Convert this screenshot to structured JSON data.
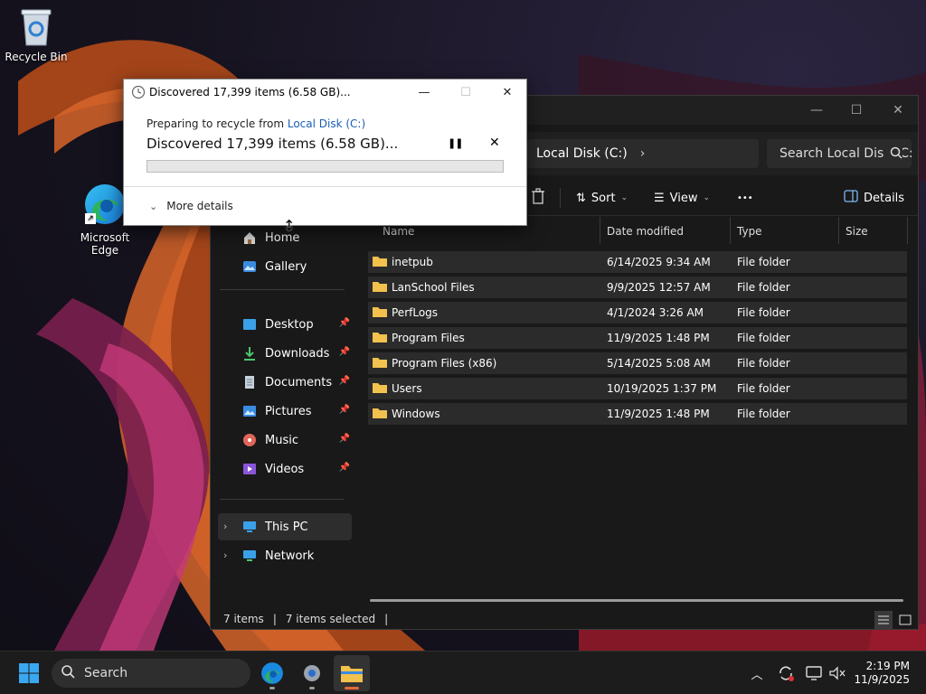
{
  "desktop": {
    "recycle_bin_label": "Recycle Bin",
    "edge_label": "Microsoft Edge"
  },
  "explorer": {
    "address": "Local Disk (C:)",
    "address_chevron": "›",
    "search_placeholder": "Search Local Disk (C:)",
    "toolbar": {
      "sort": "Sort",
      "view": "View",
      "more": "•••",
      "details": "Details"
    },
    "nav": {
      "home": "Home",
      "gallery": "Gallery",
      "pinned": [
        {
          "label": "Desktop",
          "icon": "desktop-icon"
        },
        {
          "label": "Downloads",
          "icon": "downloads-icon"
        },
        {
          "label": "Documents",
          "icon": "documents-icon"
        },
        {
          "label": "Pictures",
          "icon": "pictures-icon"
        },
        {
          "label": "Music",
          "icon": "music-icon"
        },
        {
          "label": "Videos",
          "icon": "videos-icon"
        }
      ],
      "this_pc": "This PC",
      "network": "Network"
    },
    "columns": {
      "name": "Name",
      "date": "Date modified",
      "type": "Type",
      "size": "Size"
    },
    "rows": [
      {
        "name": "inetpub",
        "date": "6/14/2025 9:34 AM",
        "type": "File folder"
      },
      {
        "name": "LanSchool Files",
        "date": "9/9/2025 12:57 AM",
        "type": "File folder"
      },
      {
        "name": "PerfLogs",
        "date": "4/1/2024 3:26 AM",
        "type": "File folder"
      },
      {
        "name": "Program Files",
        "date": "11/9/2025 1:48 PM",
        "type": "File folder"
      },
      {
        "name": "Program Files (x86)",
        "date": "5/14/2025 5:08 AM",
        "type": "File folder"
      },
      {
        "name": "Users",
        "date": "10/19/2025 1:37 PM",
        "type": "File folder"
      },
      {
        "name": "Windows",
        "date": "11/9/2025 1:48 PM",
        "type": "File folder"
      }
    ],
    "status": {
      "items": "7 items",
      "selected": "7 items selected"
    }
  },
  "dialog": {
    "title": "Discovered 17,399 items (6.58 GB)...",
    "preparing_text": "Preparing to recycle from ",
    "source_link": "Local Disk (C:)",
    "headline": "Discovered 17,399 items (6.58 GB)...",
    "progress": 0,
    "more_details": "More details"
  },
  "taskbar": {
    "search_label": "Search",
    "time": "2:19 PM",
    "date": "11/9/2025"
  },
  "colors": {
    "folder": "#f2c14e",
    "accent_link": "#1a5fb4",
    "row_bg": "#2b2b2b"
  }
}
